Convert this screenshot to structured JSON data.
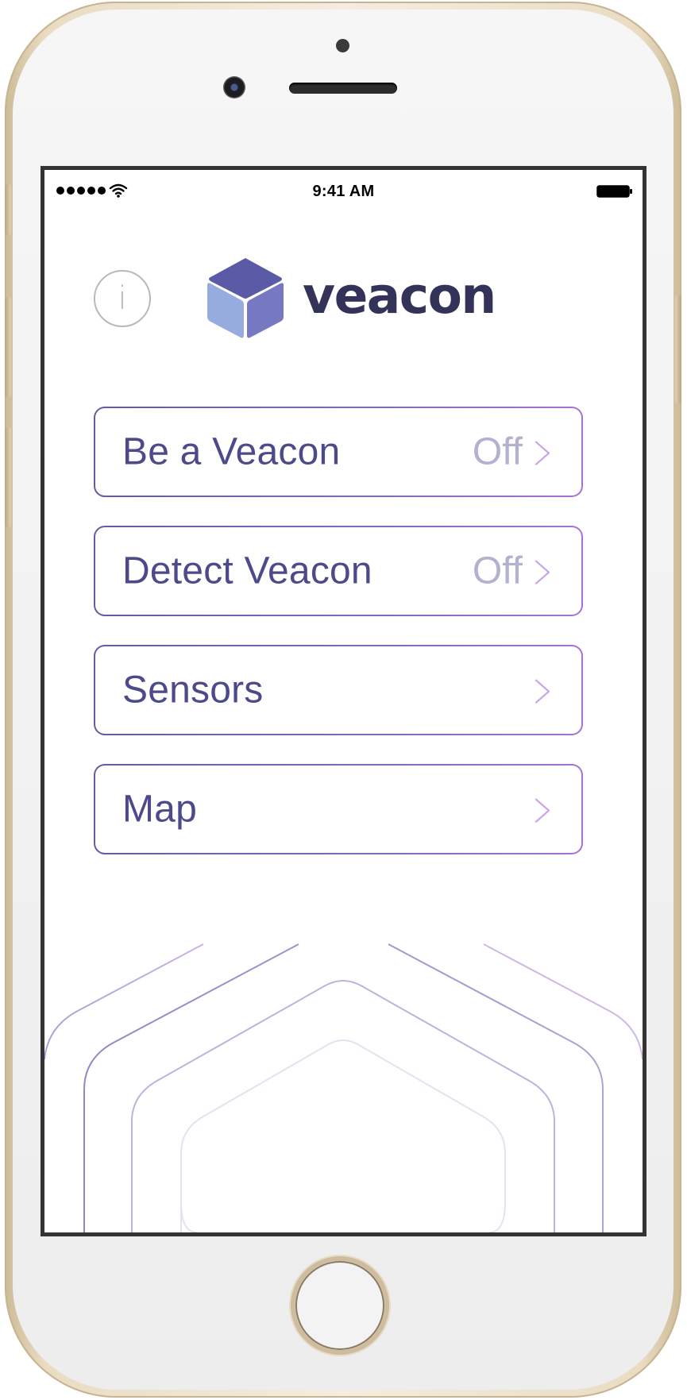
{
  "status_bar": {
    "time": "9:41 AM"
  },
  "header": {
    "info_label": "i",
    "logo_text": "veacon"
  },
  "menu": {
    "items": [
      {
        "label": "Be a Veacon",
        "status": "Off"
      },
      {
        "label": "Detect Veacon",
        "status": "Off"
      },
      {
        "label": "Sensors",
        "status": ""
      },
      {
        "label": "Map",
        "status": ""
      }
    ]
  },
  "colors": {
    "brand_dark": "#33335a",
    "brand_purple": "#4d4a8b",
    "status_gray": "#b3b1d0",
    "cube_top": "#5b5aa6",
    "cube_left": "#96acdf",
    "cube_right": "#7679c2"
  },
  "icons": {
    "info": "info-icon",
    "logo": "cube-icon",
    "chevron": "chevron-right-icon",
    "wifi": "wifi-icon",
    "battery": "battery-icon",
    "signal": "signal-icon"
  }
}
